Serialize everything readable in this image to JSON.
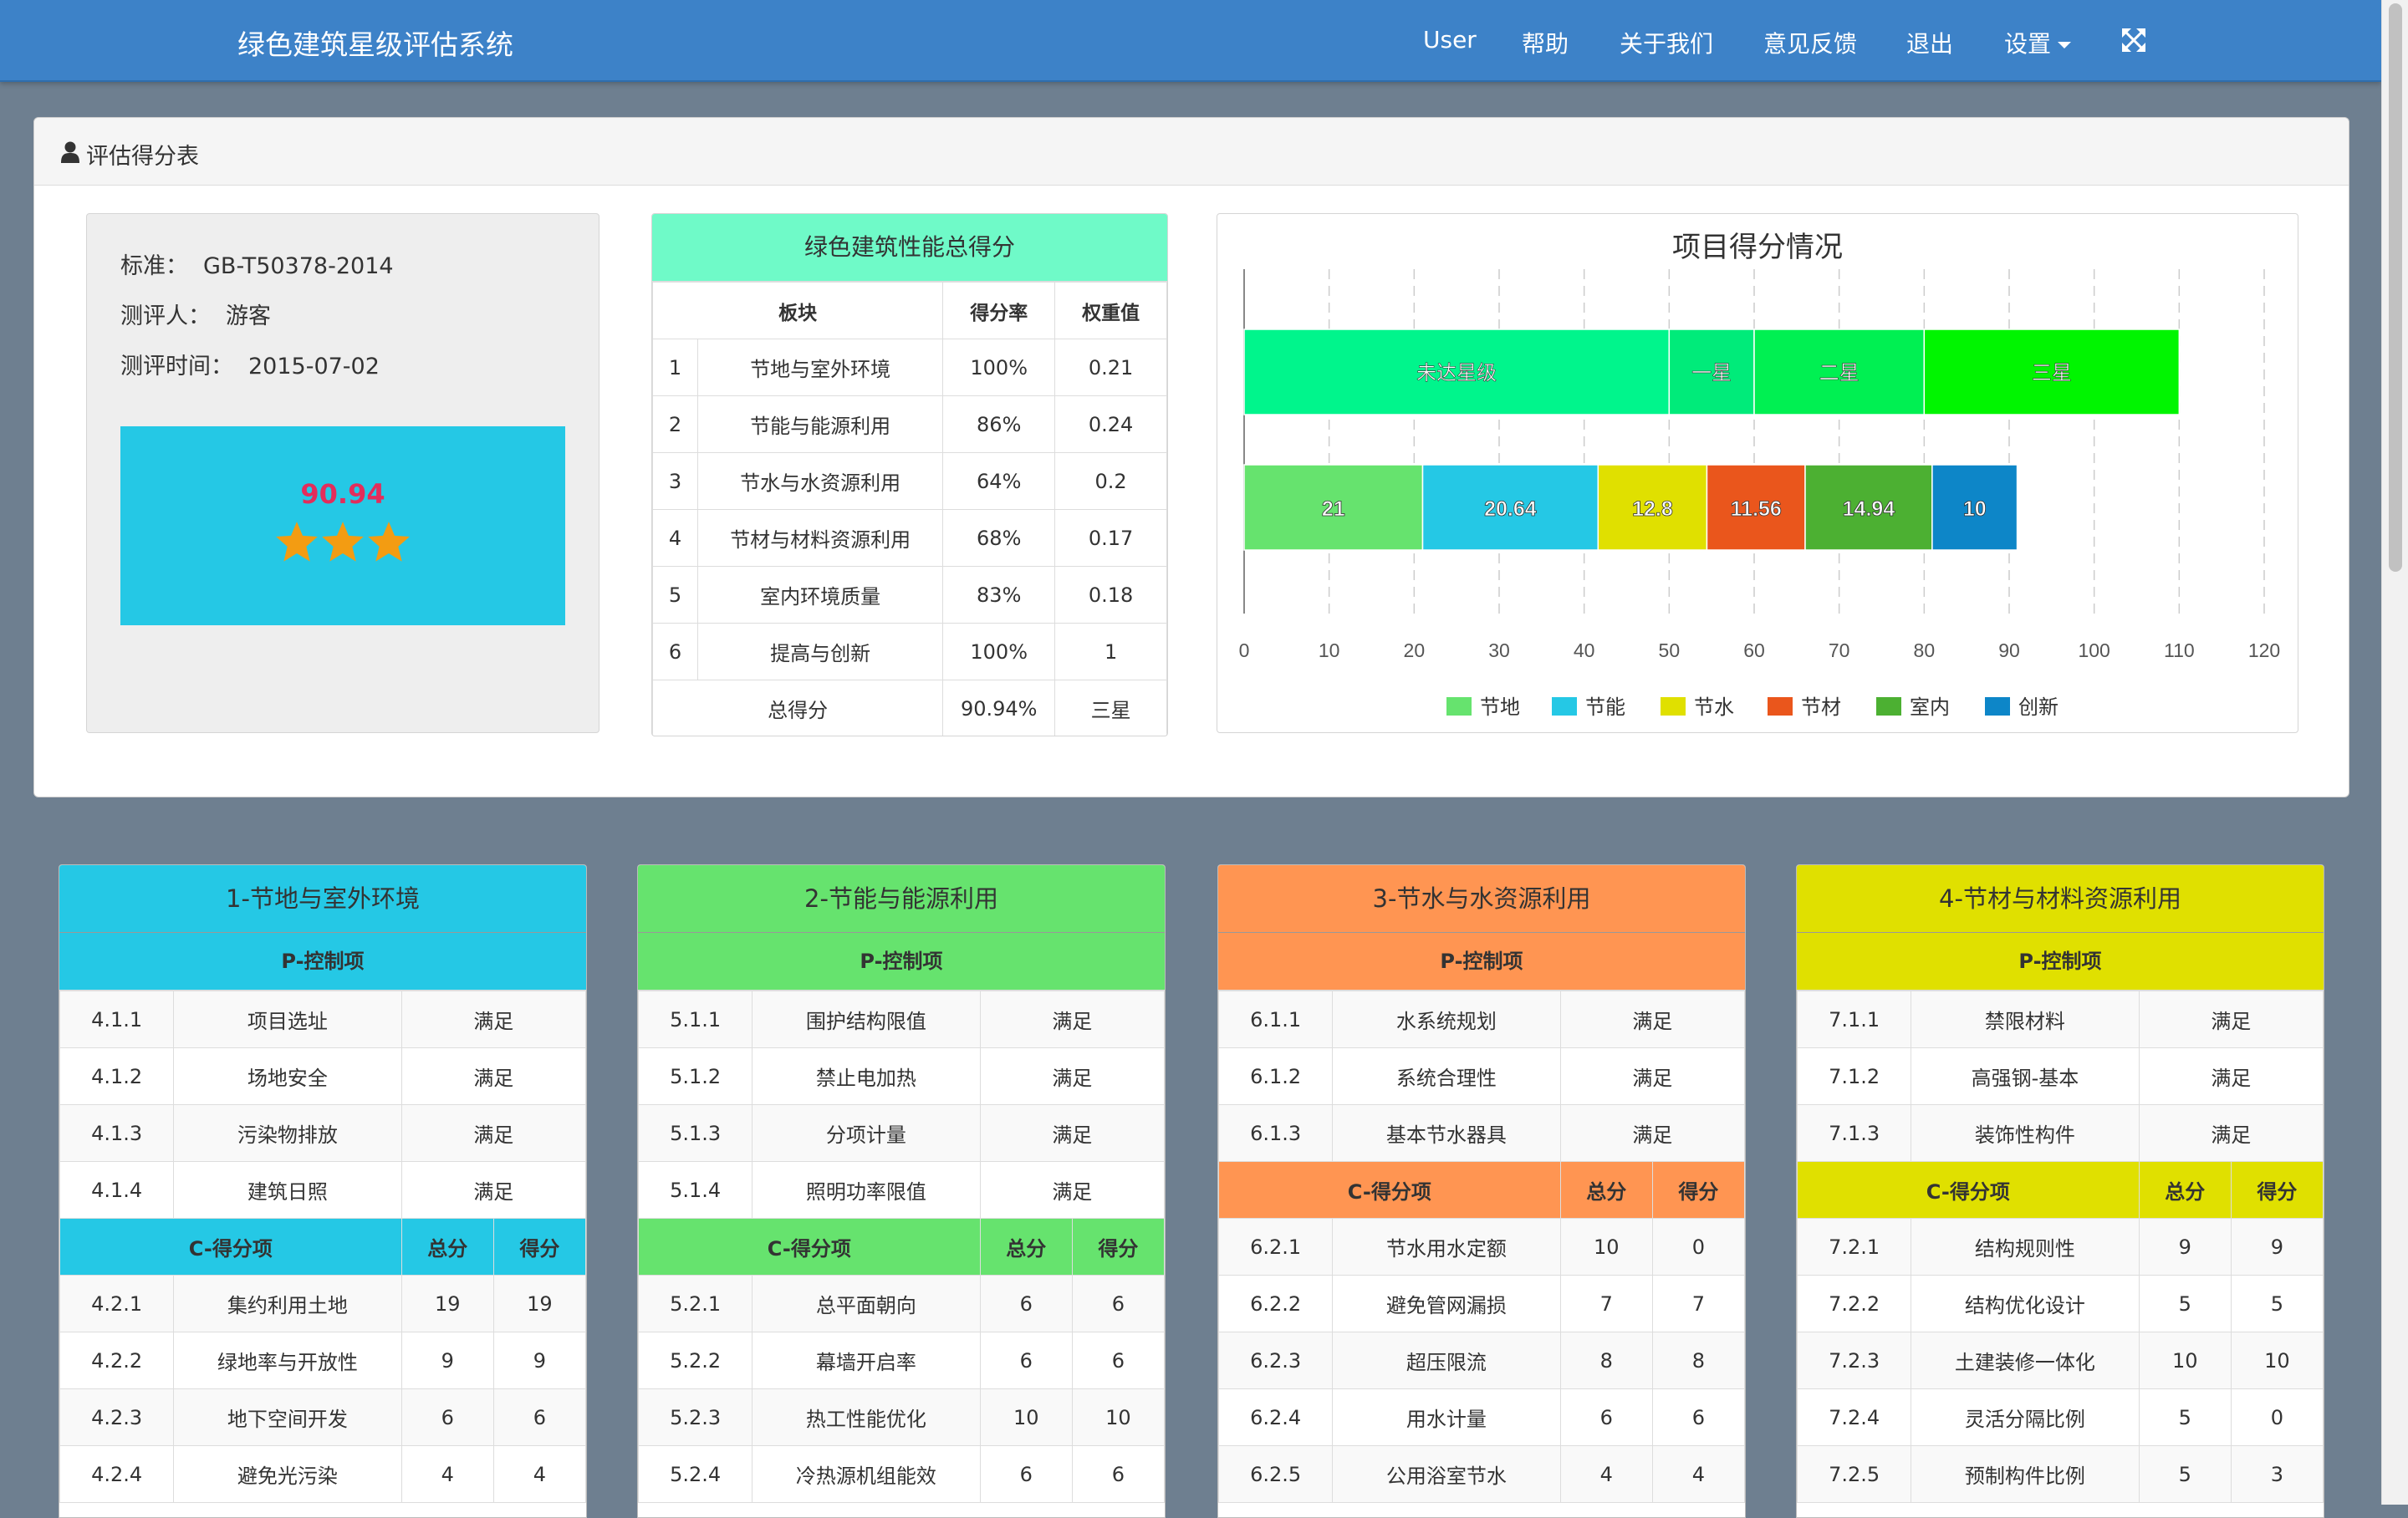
{
  "app": {
    "title": "绿色建筑星级评估系统",
    "nav": [
      "User",
      "帮助",
      "关于我们",
      "意见反馈",
      "退出",
      "设置"
    ]
  },
  "panel": {
    "title": "评估得分表",
    "standard_label": "标准：",
    "standard": "GB-T50378-2014",
    "assessor_label": "测评人：",
    "assessor": "游客",
    "time_label": "测评时间：",
    "time": "2015-07-02",
    "score": "90.94",
    "stars": 3
  },
  "total_table": {
    "title": "绿色建筑性能总得分",
    "headers": [
      "板块",
      "得分率",
      "权重值"
    ],
    "rows": [
      {
        "no": "1",
        "name": "节地与室外环境",
        "rate": "100%",
        "weight": "0.21"
      },
      {
        "no": "2",
        "name": "节能与能源利用",
        "rate": "86%",
        "weight": "0.24"
      },
      {
        "no": "3",
        "name": "节水与水资源利用",
        "rate": "64%",
        "weight": "0.2"
      },
      {
        "no": "4",
        "name": "节材与材料资源利用",
        "rate": "68%",
        "weight": "0.17"
      },
      {
        "no": "5",
        "name": "室内环境质量",
        "rate": "83%",
        "weight": "0.18"
      },
      {
        "no": "6",
        "name": "提高与创新",
        "rate": "100%",
        "weight": "1"
      }
    ],
    "total_label": "总得分",
    "total_rate": "90.94%",
    "total_level": "三星"
  },
  "chart_data": {
    "type": "bar",
    "orientation": "horizontal",
    "stacked": true,
    "title": "项目得分情况",
    "xlim": [
      0,
      120
    ],
    "xticks": [
      0,
      10,
      20,
      30,
      40,
      50,
      60,
      70,
      80,
      90,
      100,
      110,
      120
    ],
    "grid": true,
    "legend_position": "bottom",
    "levels": [
      {
        "label": "未达星级",
        "start": 0,
        "end": 50,
        "color": "#00f58c"
      },
      {
        "label": "一星",
        "start": 50,
        "end": 60,
        "color": "#00eb7a"
      },
      {
        "label": "二星",
        "start": 60,
        "end": 80,
        "color": "#00f052"
      },
      {
        "label": "三星",
        "start": 80,
        "end": 110,
        "color": "#00f500"
      }
    ],
    "series": [
      {
        "name": "节地",
        "value": 21,
        "label": "21",
        "color": "#66e36e"
      },
      {
        "name": "节能",
        "value": 20.64,
        "label": "20.64",
        "color": "#25c8e5"
      },
      {
        "name": "节水",
        "value": 12.8,
        "label": "12.8",
        "color": "#e0e000"
      },
      {
        "name": "节材",
        "value": 11.56,
        "label": "11.56",
        "color": "#ea561c"
      },
      {
        "name": "室内",
        "value": 14.94,
        "label": "14.94",
        "color": "#4cb032"
      },
      {
        "name": "创新",
        "value": 10,
        "label": "10",
        "color": "#0d86c8"
      }
    ]
  },
  "modules": [
    {
      "title": "1-节地与室外环境",
      "color": "#25c8e5",
      "p_label": "P-控制项",
      "p_items": [
        [
          "4.1.1",
          "项目选址",
          "满足"
        ],
        [
          "4.1.2",
          "场地安全",
          "满足"
        ],
        [
          "4.1.3",
          "污染物排放",
          "满足"
        ],
        [
          "4.1.4",
          "建筑日照",
          "满足"
        ]
      ],
      "c_label": "C-得分项",
      "c_total": "总分",
      "c_score": "得分",
      "c_items": [
        [
          "4.2.1",
          "集约利用土地",
          "19",
          "19"
        ],
        [
          "4.2.2",
          "绿地率与开放性",
          "9",
          "9"
        ],
        [
          "4.2.3",
          "地下空间开发",
          "6",
          "6"
        ],
        [
          "4.2.4",
          "避免光污染",
          "4",
          "4"
        ]
      ]
    },
    {
      "title": "2-节能与能源利用",
      "color": "#66e36e",
      "p_label": "P-控制项",
      "p_items": [
        [
          "5.1.1",
          "围护结构限值",
          "满足"
        ],
        [
          "5.1.2",
          "禁止电加热",
          "满足"
        ],
        [
          "5.1.3",
          "分项计量",
          "满足"
        ],
        [
          "5.1.4",
          "照明功率限值",
          "满足"
        ]
      ],
      "c_label": "C-得分项",
      "c_total": "总分",
      "c_score": "得分",
      "c_items": [
        [
          "5.2.1",
          "总平面朝向",
          "6",
          "6"
        ],
        [
          "5.2.2",
          "幕墙开启率",
          "6",
          "6"
        ],
        [
          "5.2.3",
          "热工性能优化",
          "10",
          "10"
        ],
        [
          "5.2.4",
          "冷热源机组能效",
          "6",
          "6"
        ]
      ]
    },
    {
      "title": "3-节水与水资源利用",
      "color": "#ff9552",
      "p_label": "P-控制项",
      "p_items": [
        [
          "6.1.1",
          "水系统规划",
          "满足"
        ],
        [
          "6.1.2",
          "系统合理性",
          "满足"
        ],
        [
          "6.1.3",
          "基本节水器具",
          "满足"
        ]
      ],
      "c_label": "C-得分项",
      "c_total": "总分",
      "c_score": "得分",
      "c_items": [
        [
          "6.2.1",
          "节水用水定额",
          "10",
          "0"
        ],
        [
          "6.2.2",
          "避免管网漏损",
          "7",
          "7"
        ],
        [
          "6.2.3",
          "超压限流",
          "8",
          "8"
        ],
        [
          "6.2.4",
          "用水计量",
          "6",
          "6"
        ],
        [
          "6.2.5",
          "公用浴室节水",
          "4",
          "4"
        ]
      ]
    },
    {
      "title": "4-节材与材料资源利用",
      "color": "#e0e000",
      "p_label": "P-控制项",
      "p_items": [
        [
          "7.1.1",
          "禁限材料",
          "满足"
        ],
        [
          "7.1.2",
          "高强钢-基本",
          "满足"
        ],
        [
          "7.1.3",
          "装饰性构件",
          "满足"
        ]
      ],
      "c_label": "C-得分项",
      "c_total": "总分",
      "c_score": "得分",
      "c_items": [
        [
          "7.2.1",
          "结构规则性",
          "9",
          "9"
        ],
        [
          "7.2.2",
          "结构优化设计",
          "5",
          "5"
        ],
        [
          "7.2.3",
          "土建装修一体化",
          "10",
          "10"
        ],
        [
          "7.2.4",
          "灵活分隔比例",
          "5",
          "0"
        ],
        [
          "7.2.5",
          "预制构件比例",
          "5",
          "3"
        ]
      ]
    }
  ]
}
